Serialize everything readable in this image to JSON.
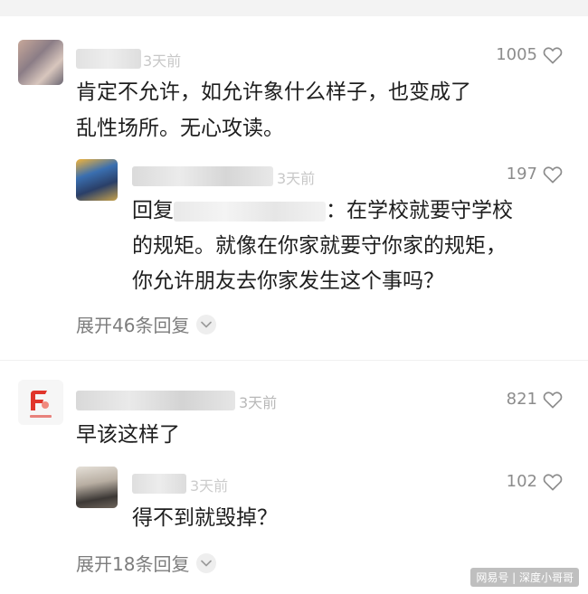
{
  "comments": [
    {
      "time": "3天前",
      "likes": "1005",
      "lines": [
        "肯定不允许，如允许象什么样子，也变成了",
        "乱性场所。无心攻读。"
      ],
      "replies": [
        {
          "time": "3天前",
          "likes": "197",
          "reply_prefix": "回复",
          "reply_tail": "：在学校就要守学校",
          "lines": [
            "的规矩。就像在你家就要守你家的规矩，",
            "你允许朋友去你家发生这个事吗？"
          ]
        }
      ],
      "expand_label": "展开46条回复"
    },
    {
      "time": "3天前",
      "likes": "821",
      "lines": [
        "早该这样了"
      ],
      "replies": [
        {
          "time": "3天前",
          "likes": "102",
          "lines": [
            "得不到就毁掉？"
          ]
        }
      ],
      "expand_label": "展开18条回复"
    }
  ],
  "watermark": "网易号 | 深度小哥哥",
  "colors": {
    "text": "#1e1e1e",
    "muted": "#9a9a9a",
    "like": "#8c8c8c",
    "logo_red": "#e0352b"
  }
}
